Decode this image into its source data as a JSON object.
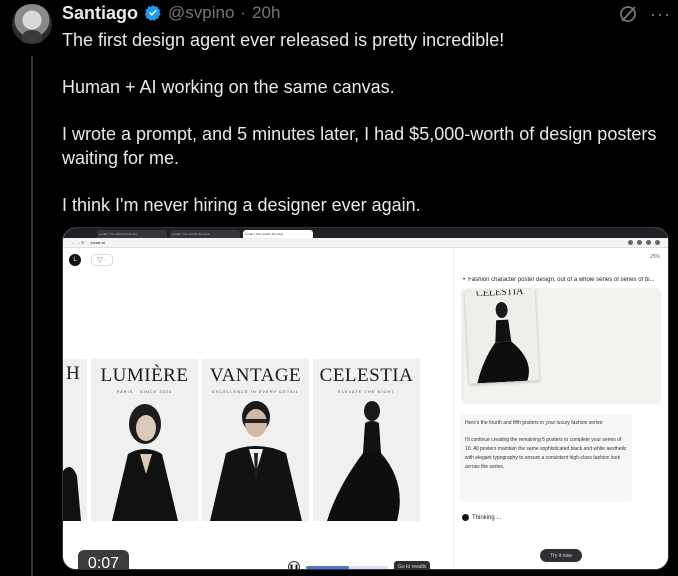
{
  "author": {
    "name": "Santiago",
    "handle": "@svpino",
    "separator": "·",
    "time": "20h"
  },
  "tweet": {
    "lines": [
      "The first design agent ever released is pretty incredible!",
      "Human + AI working on the same canvas.",
      "I wrote a prompt, and 5 minutes later, I had $5,000-worth of design posters waiting for me.",
      "I think I'm never hiring a designer ever again."
    ]
  },
  "video": {
    "timestamp": "0:07",
    "progress_fraction": 0.52,
    "browser": {
      "tabs": [
        "Lovart | The World's First De",
        "Lovart | The world's first desi",
        "Lovart | The world's first desi"
      ],
      "url": "lovart.ai"
    },
    "canvas": {
      "logo": "L",
      "shape_tool": "▽ ·",
      "posters": [
        {
          "title": "H",
          "subtitle": ""
        },
        {
          "title": "LUMIÈRE",
          "subtitle": "PARIS · SINCE 2024"
        },
        {
          "title": "VANTAGE",
          "subtitle": "EXCELLENCE IN EVERY DETAIL"
        },
        {
          "title": "CELESTIA",
          "subtitle": "ELEVATE THE NIGHT"
        }
      ],
      "go_to_results": "Go to results"
    },
    "panel": {
      "zoom": "25%",
      "title": "Fashion character poster design, out of a whole series of series of bi...",
      "thumb_title": "CELESTIA",
      "message_1": "Here's the fourth and fifth posters in your luxury fashion series:",
      "message_2": "I'll continue creating the remaining 5 posters to complete your series of 10. All posters maintain the same sophisticated black and white aesthetic with elegant typography to ensure a consistent high-class fashion look across the series.",
      "thinking": "Thinking ...",
      "try_button": "Try it now"
    }
  },
  "colors": {
    "background": "#000000",
    "text": "#e7e9ea",
    "muted": "#71767b",
    "verified": "#1d9bf0"
  }
}
